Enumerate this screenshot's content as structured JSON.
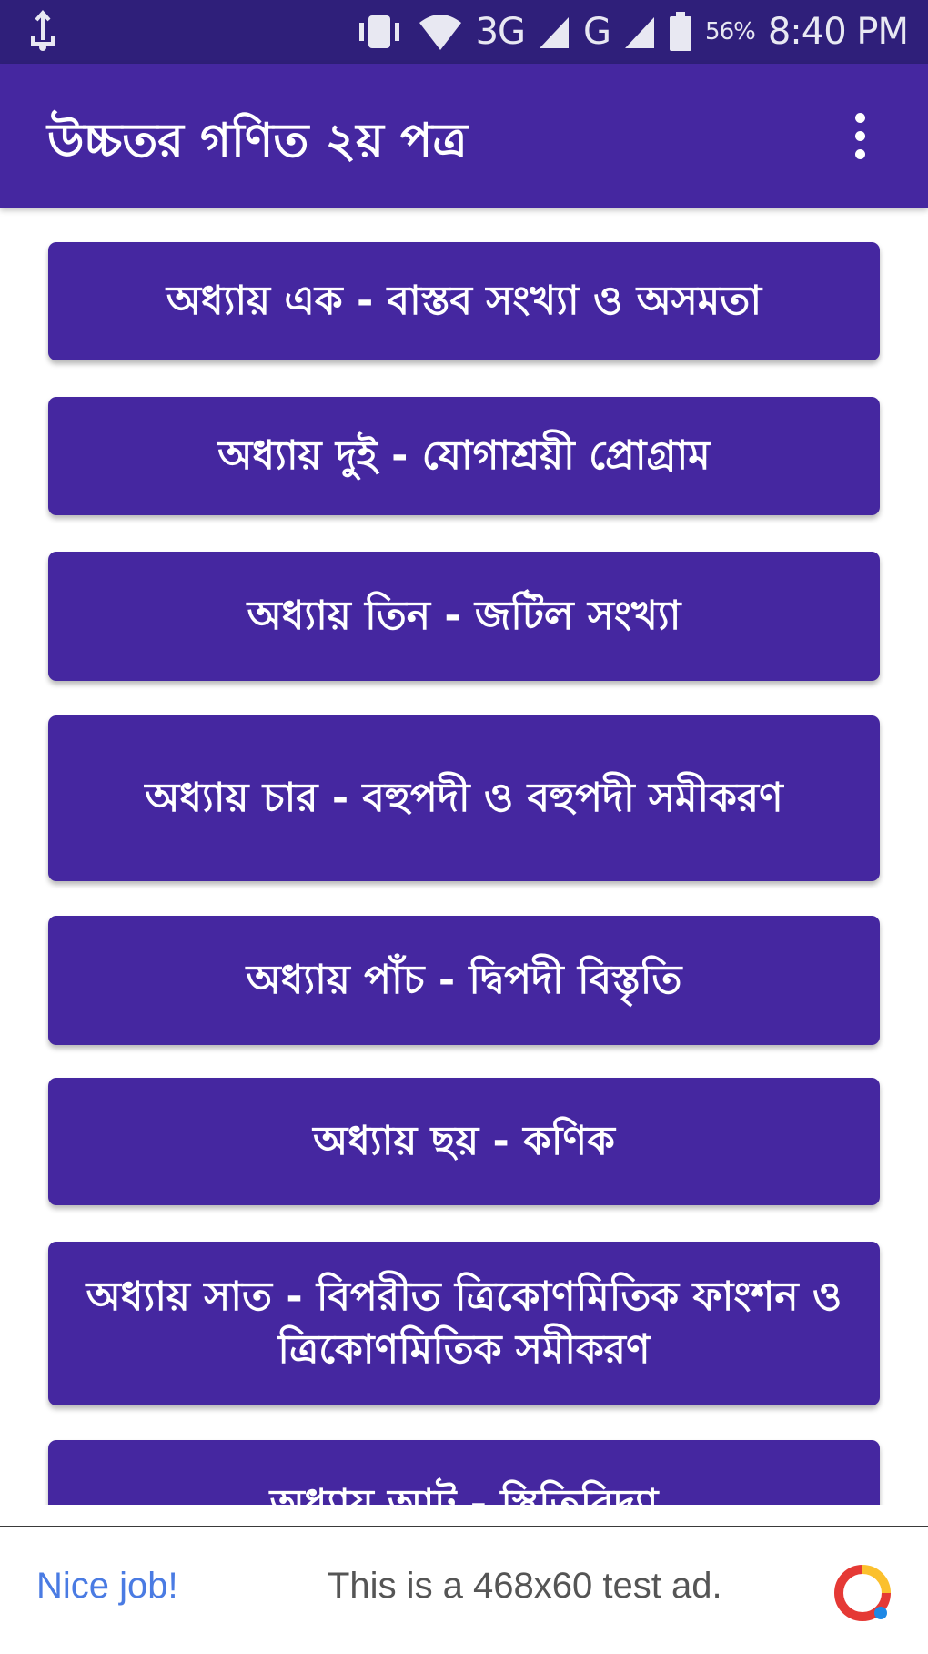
{
  "status_bar": {
    "network_3g": "3G",
    "network_g": "G",
    "battery": "56%",
    "time": "8:40 PM"
  },
  "app_bar": {
    "title": "উচ্চতর গণিত ২য় পত্র",
    "menu_icon": "more-vert-icon"
  },
  "chapters": [
    {
      "label": "অধ্যায় এক - বাস্তব সংখ্যা ও অসমতা"
    },
    {
      "label": "অধ্যায় দুই - যোগাশ্রয়ী প্রোগ্রাম"
    },
    {
      "label": "অধ্যায় তিন - জটিল সংখ্যা"
    },
    {
      "label": "অধ্যায় চার - বহুপদী ও বহুপদী সমীকরণ"
    },
    {
      "label": "অধ্যায় পাঁচ - দ্বিপদী বিস্তৃতি"
    },
    {
      "label": "অধ্যায় ছয় - কণিক"
    },
    {
      "label": "অধ্যায় সাত - বিপরীত ত্রিকোণমিতিক ফাংশন ও ত্রিকোণমিতিক সমীকরণ"
    },
    {
      "label": "অধ্যায় আট - স্থিতিবিদ্যা"
    }
  ],
  "ad": {
    "nice_job": "Nice job!",
    "text": "This is a 468x60 test ad.",
    "icon": "adchoices-icon"
  },
  "colors": {
    "status_bar": "#2f1f7a",
    "primary": "#4527a0",
    "ad_link": "#4a7be3"
  }
}
